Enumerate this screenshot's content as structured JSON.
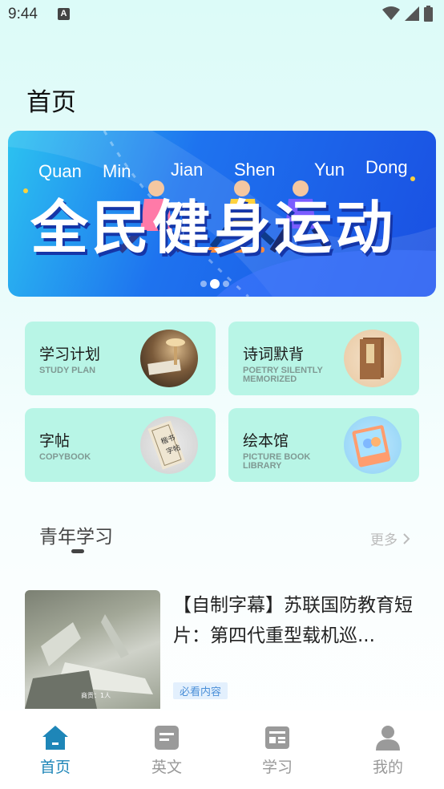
{
  "status": {
    "time": "9:44",
    "notif": "A"
  },
  "page_title": "首页",
  "banner": {
    "words": [
      "Quan",
      "Min",
      "Jian",
      "Shen",
      "Yun",
      "Dong"
    ],
    "headline": "全民健身运动",
    "dots": 3,
    "active_dot": 1
  },
  "cards": [
    {
      "title": "学习计划",
      "subtitle": "STUDY PLAN"
    },
    {
      "title": "诗词默背",
      "subtitle": "POETRY SILENTLY MEMORIZED"
    },
    {
      "title": "字帖",
      "subtitle": "COPYBOOK"
    },
    {
      "title": "绘本馆",
      "subtitle": "PICTURE BOOK LIBRARY"
    }
  ],
  "section": {
    "title": "青年学习",
    "more": "更多"
  },
  "article": {
    "title": "【自制字幕】苏联国防教育短片：第四代重型载机巡...",
    "tag": "必看内容",
    "thumb_caption": "商贡：1人"
  },
  "tabs": [
    {
      "label": "首页",
      "icon": "home-icon",
      "active": true
    },
    {
      "label": "英文",
      "icon": "document-icon",
      "active": false
    },
    {
      "label": "学习",
      "icon": "news-icon",
      "active": false
    },
    {
      "label": "我的",
      "icon": "user-icon",
      "active": false
    }
  ],
  "colors": {
    "accent": "#1e86b8",
    "card_bg": "#b8f5e6",
    "tag_text": "#4a8fd8"
  }
}
